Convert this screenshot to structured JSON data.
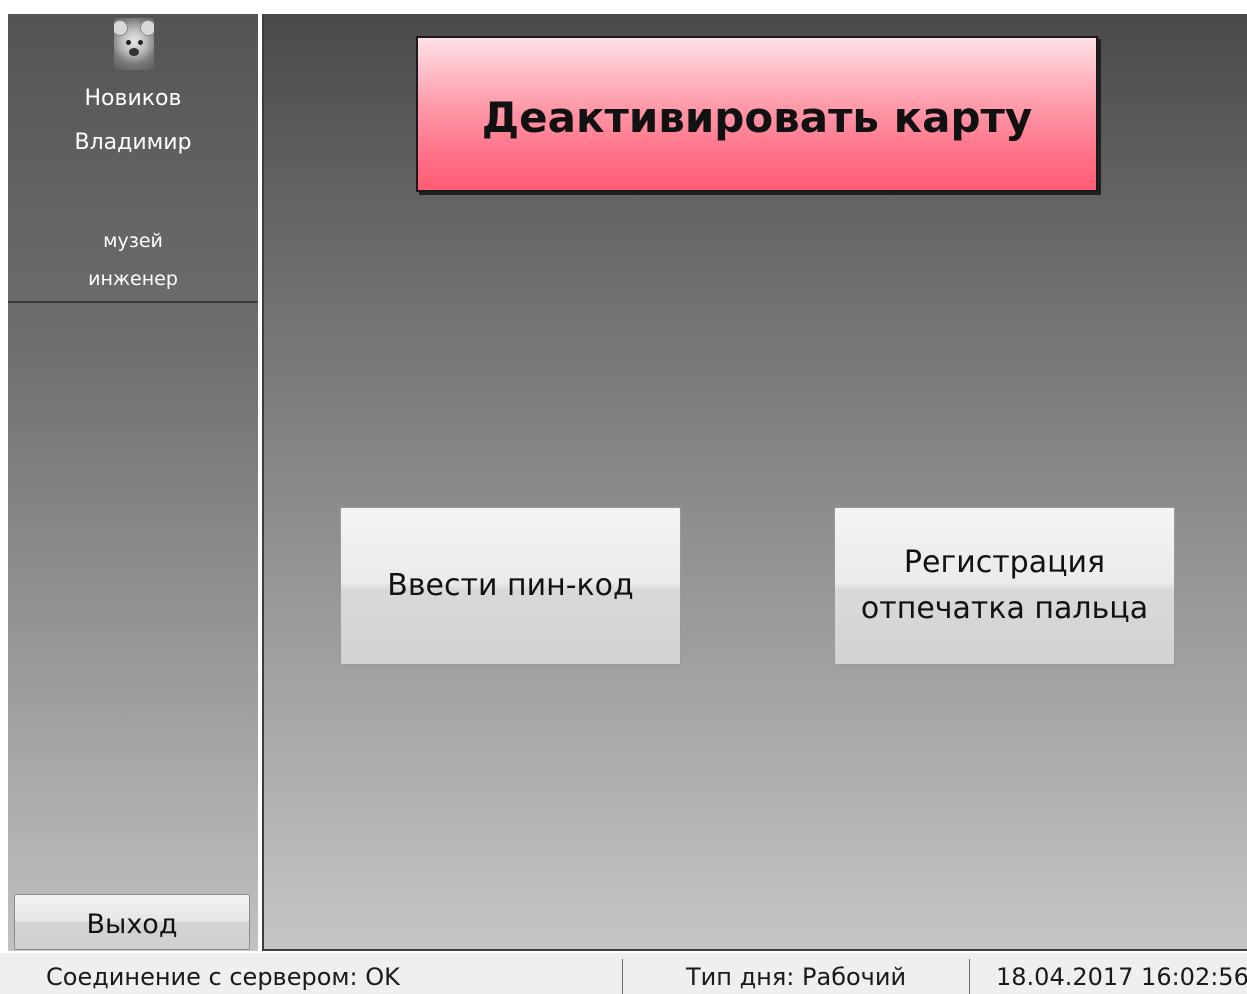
{
  "user": {
    "avatar_icon": "koala-avatar-icon",
    "last_name": "Новиков",
    "first_name": "Владимир",
    "department": "музей",
    "position": "инженер"
  },
  "sidebar": {
    "exit_label": "Выход"
  },
  "main": {
    "deactivate_label": "Деактивировать карту",
    "deactivate_color": "#ff7388",
    "pin_label": "Ввести пин-код",
    "fingerprint_label_line1": "Регистрация",
    "fingerprint_label_line2": "отпечатка пальца"
  },
  "statusbar": {
    "connection": "Соединение с сервером: OK",
    "day_type": "Тип дня: Рабочий",
    "datetime": "18.04.2017 16:02:56"
  }
}
